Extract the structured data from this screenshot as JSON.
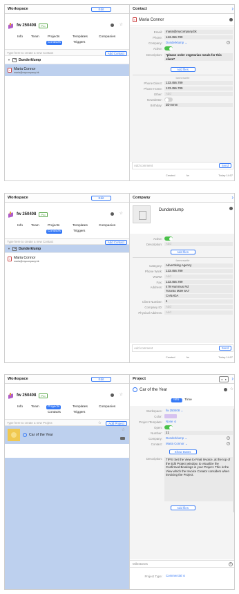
{
  "common": {
    "workspace_title": "Workspace",
    "edit_label": "Edit",
    "workspace_name": "fw 250408",
    "pro_badge": "Pro",
    "tabs": [
      "Info",
      "Team",
      "Projects",
      "Templates",
      "Companies",
      "Contacts",
      "Triggers"
    ],
    "group_name": "Dunderklump",
    "contact_name": "Maria Connor",
    "contact_email": "maria@mycompany.bk",
    "add_comment_placeholder": "Add comment",
    "send_label": "Send",
    "add_files_label": "Add files",
    "section_label": "farmerseife",
    "created_label": "Created",
    "created_by": "fw",
    "created_time": "Today 14:07",
    "accent": "#3478f6"
  },
  "panel1": {
    "search_placeholder": "Type here to create a new Contact",
    "add_button": "Add Contact",
    "right_title": "Contact",
    "fields": [
      {
        "label": "Email:",
        "value": "maria@mycompany.bk"
      },
      {
        "label": "Phone:",
        "value": "123.456.789"
      },
      {
        "label": "Company:",
        "value": "Dunderklump ⌄"
      },
      {
        "label": "Active:",
        "value": ""
      },
      {
        "label": "Description:",
        "value": "*please order vegetarian meals for this client*"
      }
    ],
    "extra_fields": [
      {
        "label": "Phone Direct:",
        "value": "123.456.789"
      },
      {
        "label": "Phone Home:",
        "value": "123.456.789"
      },
      {
        "label": "Other:",
        "value": "Add"
      },
      {
        "label": "Newsletter:",
        "value": ""
      },
      {
        "label": "Birthday:",
        "value": "dd-mmm"
      }
    ]
  },
  "panel2": {
    "search_placeholder": "Type here to create a new Contact",
    "add_button": "Add Contact",
    "right_title": "Company",
    "company_name": "Dunderklump",
    "fields": [
      {
        "label": "Active:",
        "value": ""
      },
      {
        "label": "Description:",
        "value": "Add"
      }
    ],
    "extra_fields": [
      {
        "label": "Category:",
        "value": "Advertising Agency"
      },
      {
        "label": "Phone Work:",
        "value": "123.456.789"
      },
      {
        "label": "WWW:",
        "value": "Add"
      },
      {
        "label": "Fax:",
        "value": "123.456.789"
      },
      {
        "label": "Address:",
        "value": "479 Hummus Rd"
      },
      {
        "label": "",
        "value": "Toronto M3H 6A7"
      },
      {
        "label": "",
        "value": "CANADA"
      },
      {
        "label": "Client Number:",
        "value": "4"
      },
      {
        "label": "Company ID:",
        "value": "Add"
      },
      {
        "label": "Physical Address:",
        "value": "Add"
      }
    ]
  },
  "panel3": {
    "search_placeholder": "Type here to create a new Project",
    "add_button": "Add Project",
    "right_title": "Project",
    "project_name": "Car of the Year",
    "seg_info": "Info",
    "seg_time": "Time",
    "fields": [
      {
        "label": "Workspace:",
        "value": "fw 250408 ⌄"
      },
      {
        "label": "Color:",
        "value": ""
      },
      {
        "label": "Project Template:",
        "value": "None ≎"
      },
      {
        "label": "Open:",
        "value": ""
      },
      {
        "label": "Number:",
        "value": "21"
      },
      {
        "label": "Company:",
        "value": "Dunderklump ⌄"
      },
      {
        "label": "Contact:",
        "value": "Maria Connor ⌄"
      }
    ],
    "show_dates": "Show Dates",
    "description_label": "Description:",
    "description": "TIPS! Set the View to Final Invoice, at the top of the Edit Project window, to visualize the Confirmed Bookings in your Project. This is the View which the Invoice Creator considers when invoicing the Project.",
    "milestones": "Milestones",
    "project_type_label": "Project Type:",
    "project_type_value": "Commercial ≎"
  }
}
